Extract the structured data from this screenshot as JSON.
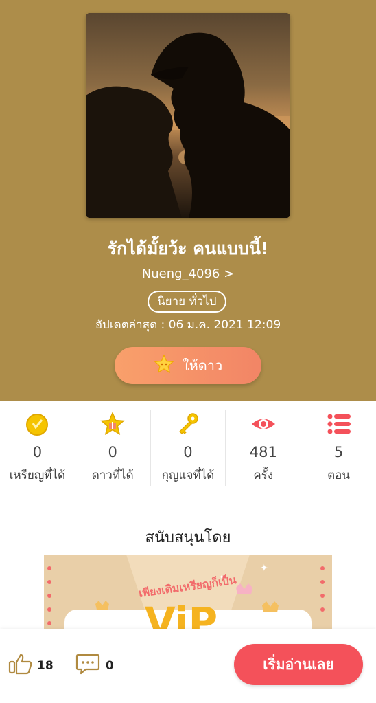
{
  "story": {
    "title": "รักได้มั้ยว้ะ คนแบบนี้!",
    "author": "Nueng_4096 >",
    "genre": "นิยาย ทั่วไป",
    "updated": "อัปเดตล่าสุด : 06 ม.ค. 2021 12:09",
    "give_star_label": "ให้ดาว"
  },
  "stats": [
    {
      "icon": "coin-medal-icon",
      "value": "0",
      "label": "เหรียญที่ได้"
    },
    {
      "icon": "star-gift-icon",
      "value": "0",
      "label": "ดาวที่ได้"
    },
    {
      "icon": "key-icon",
      "value": "0",
      "label": "กุญแจที่ได้"
    },
    {
      "icon": "eye-icon",
      "value": "481",
      "label": "ครั้ง"
    },
    {
      "icon": "list-icon",
      "value": "5",
      "label": "ตอน"
    }
  ],
  "support": {
    "title": "สนับสนุนโดย",
    "banner_text": "เพียงเติมเหรียญก็เป็น",
    "banner_logo": "ViP"
  },
  "bottom": {
    "likes": "18",
    "comments": "0",
    "read_label": "เริ่มอ่านเลย"
  },
  "colors": {
    "hero_bg": "#ad8d4a",
    "star_button": "#f28566",
    "read_button": "#f4515a",
    "stat_red": "#f4515a",
    "coin_yellow": "#f5c400"
  }
}
